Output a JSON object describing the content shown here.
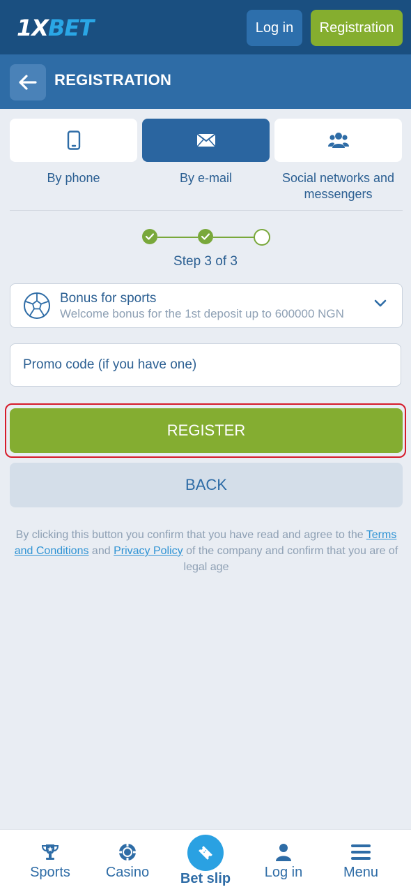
{
  "header": {
    "logo_part1": "1X",
    "logo_part2": "BET",
    "login_label": "Log in",
    "registration_label": "Registration"
  },
  "page": {
    "title": "REGISTRATION"
  },
  "tabs": [
    {
      "label": "By phone",
      "icon": "phone-icon",
      "active": false
    },
    {
      "label": "By e-mail",
      "icon": "envelope-icon",
      "active": true
    },
    {
      "label": "Social networks and messengers",
      "icon": "users-icon",
      "active": false
    }
  ],
  "stepper": {
    "text": "Step 3 of 3",
    "current": 3,
    "total": 3
  },
  "bonus": {
    "title": "Bonus for sports",
    "subtitle": "Welcome bonus for the 1st deposit up to 600000 NGN"
  },
  "promo": {
    "placeholder": "Promo code (if you have one)",
    "value": ""
  },
  "buttons": {
    "register": "REGISTER",
    "back": "BACK"
  },
  "terms": {
    "before": "By clicking this button you confirm that you have read and agree to the ",
    "terms_link": "Terms and Conditions",
    "middle": " and ",
    "privacy_link": "Privacy Policy",
    "after": " of the company and confirm that you are of legal age"
  },
  "bottom_nav": [
    {
      "label": "Sports",
      "icon": "trophy-icon"
    },
    {
      "label": "Casino",
      "icon": "casino-chip-icon"
    },
    {
      "label": "Bet slip",
      "icon": "ticket-icon"
    },
    {
      "label": "Log in",
      "icon": "user-icon"
    },
    {
      "label": "Menu",
      "icon": "hamburger-menu-icon"
    }
  ],
  "colors": {
    "topbar": "#1a4f80",
    "headerbar": "#2e6ca6",
    "accent_green": "#84ad31",
    "highlight_red": "#d61b2a"
  }
}
